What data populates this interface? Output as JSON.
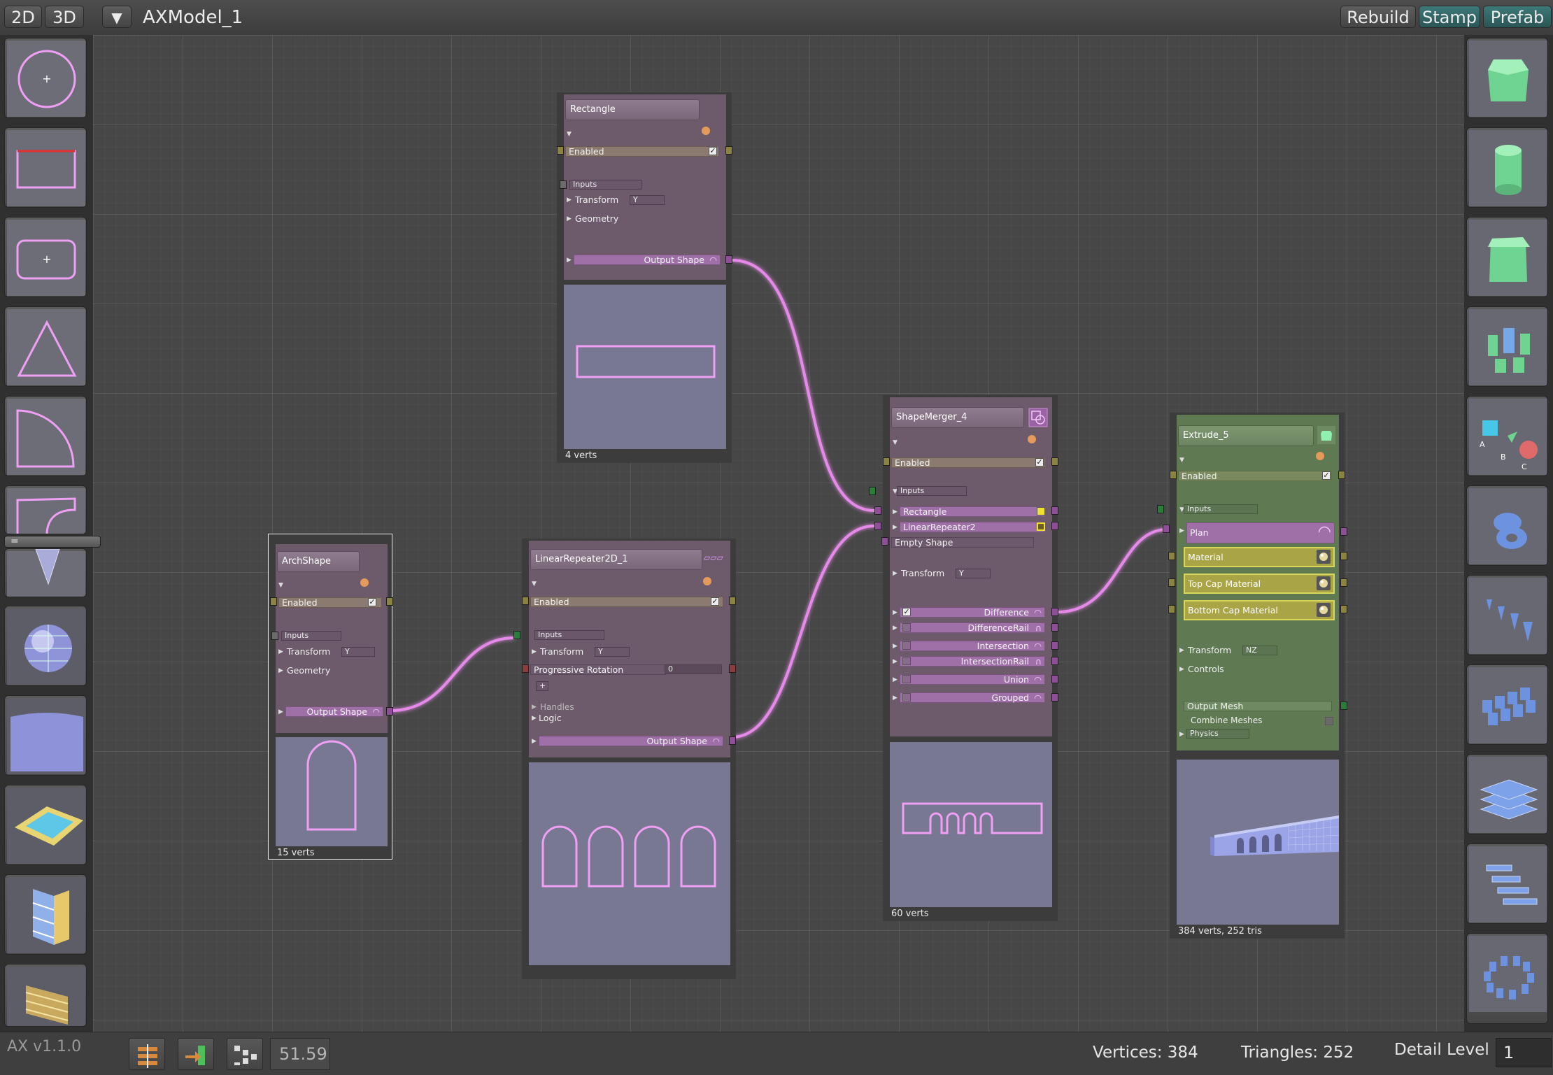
{
  "topbar": {
    "btn_2d": "2D",
    "btn_3d": "3D",
    "menu_icon": "triangle-down-icon",
    "model_name": "AXModel_1",
    "rebuild": "Rebuild",
    "stamp": "Stamp",
    "prefab": "Prefab"
  },
  "left_palette": {
    "collapse_label": "=",
    "tools": [
      "circle-shape-icon",
      "rectangle-shape-icon",
      "rounded-rect-shape-icon",
      "triangle-shape-icon",
      "quarter-arc-shape-icon",
      "curve-shape-icon",
      "cone-mesh-icon",
      "sphere-mesh-icon",
      "curved-plane-icon",
      "pool-icon",
      "building-icon",
      "stair-grid-icon"
    ]
  },
  "right_palette": {
    "tools": [
      "extrude-octagon-icon",
      "extrude-cylinder-icon",
      "extrude-fluted-icon",
      "scatter-cylinders-icon",
      "abc-repeater-icon",
      "torus-icon",
      "linear-cones-icon",
      "grid-cylinders-icon",
      "stacked-plates-icon",
      "stairs-icon",
      "radial-cylinders-icon"
    ]
  },
  "nodes": {
    "rectangle": {
      "name": "Rectangle",
      "enabled": "Enabled",
      "inputs": "Inputs",
      "transform": "Transform",
      "transform_axis": "Y",
      "geometry": "Geometry",
      "output": "Output Shape",
      "verts": "4 verts"
    },
    "arch": {
      "name": "ArchShape",
      "enabled": "Enabled",
      "inputs": "Inputs",
      "transform": "Transform",
      "transform_axis": "Y",
      "geometry": "Geometry",
      "output": "Output Shape",
      "verts": "15 verts"
    },
    "repeater": {
      "name": "LinearRepeater2D_1",
      "enabled": "Enabled",
      "inputs": "Inputs",
      "transform": "Transform",
      "transform_axis": "Y",
      "prog_rot": "Progressive Rotation",
      "prog_rot_value": "0",
      "add": "+",
      "handles": "Handles",
      "logic": "Logic",
      "output": "Output Shape"
    },
    "merger": {
      "name": "ShapeMerger_4",
      "enabled": "Enabled",
      "inputs": "Inputs",
      "in1": "Rectangle",
      "in2": "LinearRepeater2",
      "empty": "Empty Shape",
      "transform": "Transform",
      "transform_axis": "Y",
      "ops": [
        "Difference",
        "DifferenceRail",
        "Intersection",
        "IntersectionRail",
        "Union",
        "Grouped"
      ],
      "verts": "60 verts"
    },
    "extrude": {
      "name": "Extrude_5",
      "enabled": "Enabled",
      "inputs": "Inputs",
      "plan": "Plan",
      "material": "Material",
      "top_cap": "Top Cap Material",
      "bottom_cap": "Bottom Cap Material",
      "transform": "Transform",
      "transform_axis": "NZ",
      "controls": "Controls",
      "output_mesh": "Output Mesh",
      "combine": "Combine Meshes",
      "physics": "Physics",
      "verts": "384 verts, 252 tris"
    }
  },
  "status": {
    "version": "AX v1.1.0",
    "fps": "51.59",
    "vertices": "Vertices: 384",
    "triangles": "Triangles: 252",
    "detail_label": "Detail Level",
    "detail_value": "1"
  },
  "colors": {
    "wire": "#e58ae8",
    "accent_teal": "#3d7878"
  }
}
